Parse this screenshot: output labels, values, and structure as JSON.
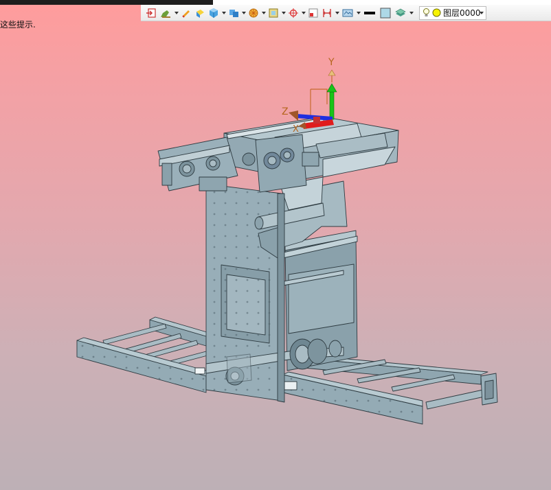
{
  "hint": {
    "text": "这些提示."
  },
  "layer": {
    "name": "图层0000"
  },
  "axes": {
    "x": "X",
    "y": "Y",
    "z": "Z"
  },
  "colors": {
    "model": "#93aab4",
    "axis_x": "#e01c1c",
    "axis_y": "#18c418",
    "axis_z": "#1f2fe0"
  },
  "icons": [
    "exit-sketch-icon",
    "pencil-brush-icon",
    "eraser-icon",
    "paint-bucket-icon",
    "cube-icon",
    "view-cube-icon",
    "sphere-shading-icon",
    "frame-icon",
    "crosshair-icon",
    "window-icon",
    "dimension-icon",
    "display-mode-icon",
    "line-color-icon",
    "fill-color-icon",
    "layer-stack-icon",
    "lightbulb-icon",
    "layer-color-icon"
  ]
}
